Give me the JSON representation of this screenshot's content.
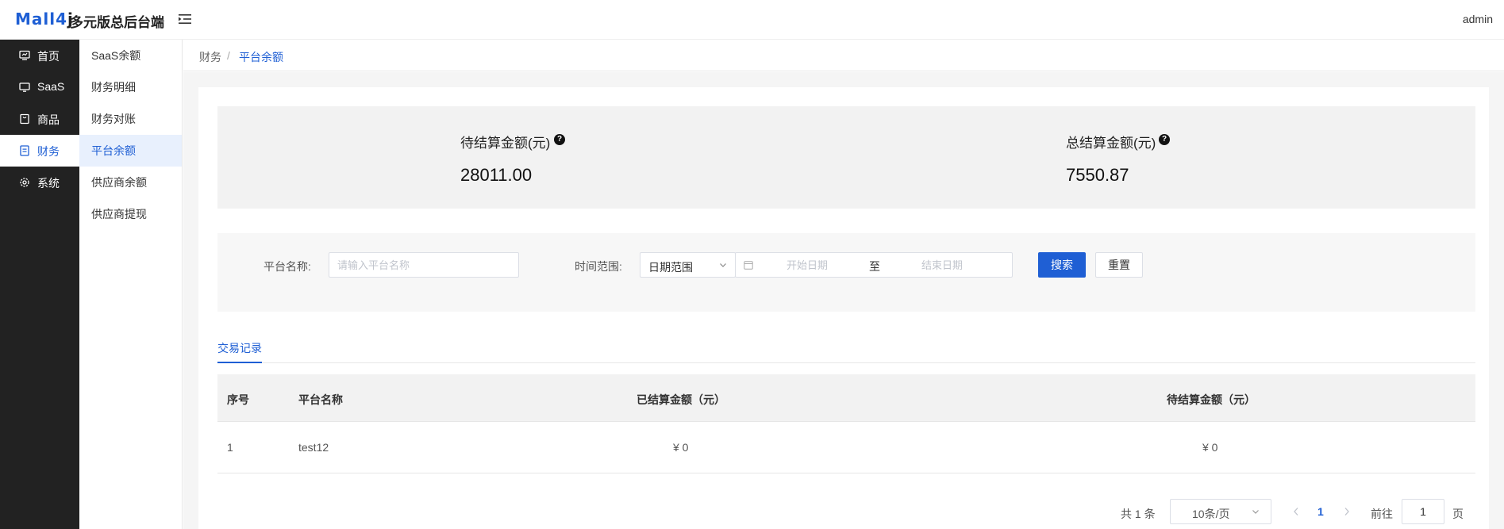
{
  "header": {
    "logo_text": "Mall4",
    "logo_j": "j",
    "title": "多元版总后台端",
    "user": "admin"
  },
  "sidebar": {
    "items": [
      {
        "label": "首页",
        "icon": "monitor-icon"
      },
      {
        "label": "SaaS",
        "icon": "screen-icon"
      },
      {
        "label": "商品",
        "icon": "bag-icon"
      },
      {
        "label": "财务",
        "icon": "document-icon",
        "active": true
      },
      {
        "label": "系统",
        "icon": "gear-icon"
      }
    ]
  },
  "submenu": {
    "items": [
      {
        "label": "SaaS余额"
      },
      {
        "label": "财务明细"
      },
      {
        "label": "财务对账"
      },
      {
        "label": "平台余额",
        "active": true
      },
      {
        "label": "供应商余额"
      },
      {
        "label": "供应商提现"
      }
    ]
  },
  "breadcrumb": {
    "parent": "财务",
    "separator": "/",
    "current": "平台余额"
  },
  "summary": {
    "pending_label": "待结算金额(元)",
    "pending_value": "28011.00",
    "total_label": "总结算金额(元)",
    "total_value": "7550.87",
    "help_glyph": "?"
  },
  "filter": {
    "platform_label": "平台名称:",
    "platform_placeholder": "请输入平台名称",
    "platform_value": "",
    "time_label": "时间范围:",
    "time_select": "日期范围",
    "start_placeholder": "开始日期",
    "range_sep": "至",
    "end_placeholder": "结束日期",
    "search_btn": "搜索",
    "reset_btn": "重置"
  },
  "tabs": {
    "active": "交易记录"
  },
  "table": {
    "columns": [
      "序号",
      "平台名称",
      "已结算金额（元）",
      "待结算金额（元）"
    ],
    "rows": [
      {
        "index": "1",
        "name": "test12",
        "settled": "¥ 0",
        "pending": "¥ 0"
      }
    ]
  },
  "pagination": {
    "total": "共 1 条",
    "page_size": "10条/页",
    "current_page": "1",
    "goto_label": "前往",
    "goto_value": "1",
    "page_suffix": "页"
  },
  "colors": {
    "primary": "#1f5fd4",
    "sidebar_bg": "#222222"
  }
}
